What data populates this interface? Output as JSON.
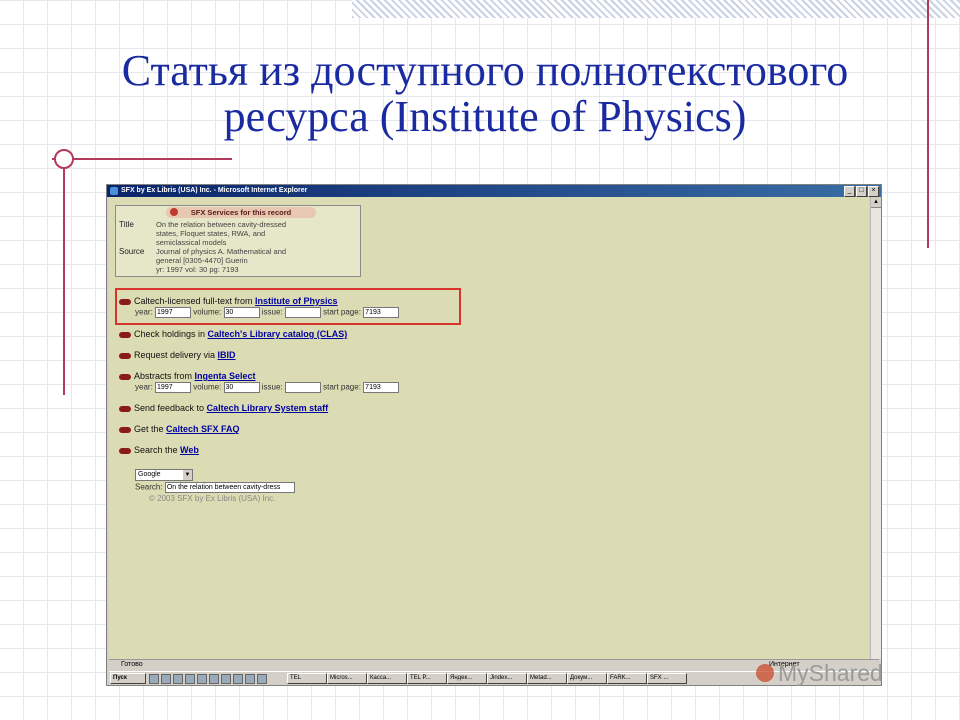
{
  "slide": {
    "title_line1": "Статья из доступного полнотекстового",
    "title_line2": "ресурса (Institute of Physics)",
    "watermark": "MyShared"
  },
  "browser": {
    "window_title": "SFX by Ex Libris (USA) Inc. - Microsoft Internet Explorer",
    "status": "Готово",
    "zone": "Интернет"
  },
  "sfx": {
    "header": "SFX Services for this record",
    "title_label": "Title",
    "title_value_1": "On the relation between cavity-dressed",
    "title_value_2": "states, Floquet states, RWA, and",
    "title_value_3": "semiclassical models",
    "source_label": "Source",
    "source_value_1": "Journal of physics A. Mathematical and",
    "source_value_2": "general [0305-4470] Guerin",
    "source_value_3": "yr: 1997 vol: 30 pg: 7193"
  },
  "services": {
    "fulltext_text": "Caltech-licensed full-text from ",
    "fulltext_link": "Institute of Physics",
    "year_label": "year:",
    "year_value": "1997",
    "volume_label": "volume:",
    "volume_value": "30",
    "issue_label": "issue:",
    "issue_value": "",
    "startpage_label": "start page:",
    "startpage_value": "7193",
    "holdings_text": "Check holdings in ",
    "holdings_link": "Caltech's Library catalog (CLAS)",
    "delivery_text": "Request delivery via ",
    "delivery_link": "IBID",
    "abstracts_text": "Abstracts from ",
    "abstracts_link": "Ingenta Select",
    "abs_year_value": "1997",
    "abs_volume_value": "30",
    "abs_issue_value": "",
    "abs_startpage_value": "7193",
    "feedback_text": "Send feedback to ",
    "feedback_link": "Caltech Library System staff",
    "faq_text": "Get the ",
    "faq_link": "Caltech SFX FAQ",
    "search_text": "Search the ",
    "search_link": "Web",
    "engine_selected": "Google",
    "search_label": "Search:",
    "search_value": "On the relation between cavity-dress",
    "copyright": "© 2003 SFX by Ex Libris (USA) Inc."
  },
  "taskbar": {
    "start": "Пуск",
    "items": [
      "TEL",
      "Micros...",
      "Касса...",
      "TEL P...",
      "Яндек...",
      "Jindex...",
      "Metad...",
      "Докум...",
      "FARK...",
      "SFX ..."
    ]
  }
}
